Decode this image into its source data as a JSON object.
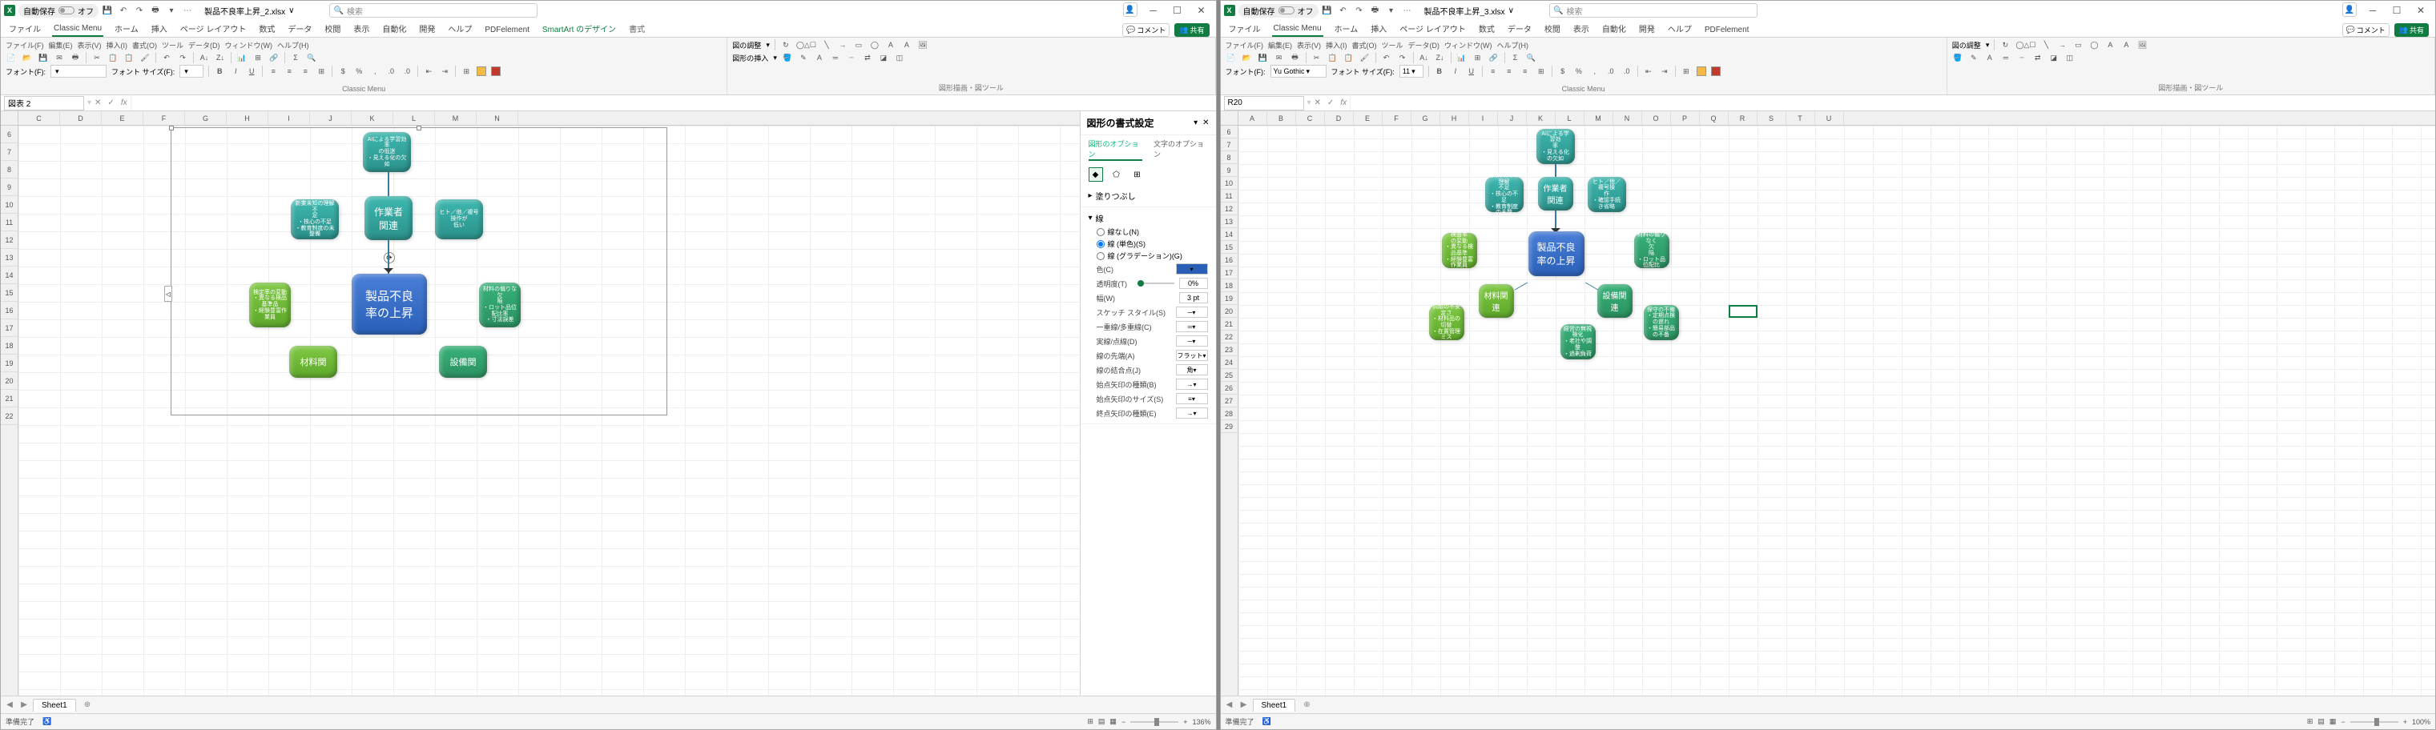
{
  "left": {
    "autosave_label": "自動保存",
    "autosave_state": "オフ",
    "filename": "製品不良率上昇_2.xlsx",
    "filestate": "∨",
    "search_placeholder": "検索",
    "tabs": [
      "ファイル",
      "Classic Menu",
      "ホーム",
      "挿入",
      "ページ レイアウト",
      "数式",
      "データ",
      "校閲",
      "表示",
      "自動化",
      "開発",
      "ヘルプ",
      "PDFelement",
      "SmartArt のデザイン",
      "書式"
    ],
    "comment_label": "コメント",
    "share_label": "共有",
    "ribbon": {
      "classic_label": "Classic Menu",
      "shape_label": "図形描画・図ツール",
      "menus": [
        "ファイル(F)",
        "編集(E)",
        "表示(V)",
        "挿入(I)",
        "書式(O)",
        "ツール",
        "データ(D)",
        "ウィンドウ(W)",
        "ヘルプ(H)"
      ],
      "font_label": "フォント(F):",
      "font_value": "",
      "size_label": "フォント サイズ(F):",
      "size_value": "",
      "adjust_label": "図の調整",
      "insert_shape_label": "図形の挿入"
    },
    "namebox": "図表 2",
    "fx_label": "fx",
    "cols": [
      "C",
      "D",
      "E",
      "F",
      "G",
      "H",
      "I",
      "J",
      "K",
      "L",
      "M",
      "N"
    ],
    "rows": [
      "6",
      "7",
      "8",
      "9",
      "10",
      "11",
      "12",
      "13",
      "14",
      "15",
      "16",
      "17",
      "18",
      "19",
      "20",
      "21",
      "22"
    ],
    "shapes": {
      "top": {
        "lines": [
          "AIによる学習効率",
          "の低迷",
          "・見える化の欠如"
        ]
      },
      "left_mid": {
        "lines": [
          "新業未知の理解不",
          "足",
          "・核心の不足",
          "・教育制度の未整備"
        ]
      },
      "right_mid": {
        "lines": [
          "ヒト／他／複号操作が",
          "低い"
        ]
      },
      "center_upper": "作業者\n関連",
      "left_green": {
        "lines": [
          "検定率の変動",
          "・異なる検品基準品",
          "・経験豊富作業員"
        ]
      },
      "right_green": {
        "lines": [
          "材料の偏りな欠",
          "陥",
          "・ロット品位配比率",
          "・寸法誤差"
        ]
      },
      "center_main": "製品不良\n率の上昇",
      "bottom_left": "材料関",
      "bottom_right": "設備関"
    },
    "fmt": {
      "title": "図形の書式設定",
      "tab_shape": "図形のオプション",
      "tab_text": "文字のオプション",
      "sec_fill": "塗りつぶし",
      "sec_line": "線",
      "radio_none": "線なし(N)",
      "radio_solid": "線 (単色)(S)",
      "radio_grad": "線 (グラデーション)(G)",
      "color_label": "色(C)",
      "trans_label": "透明度(T)",
      "trans_value": "0%",
      "width_label": "幅(W)",
      "width_value": "3 pt",
      "sketch_label": "スケッチ スタイル(S)",
      "compound_label": "一重線/多重線(C)",
      "dash_label": "実線/点線(D)",
      "cap_label": "線の先端(A)",
      "cap_value": "フラット",
      "join_label": "線の結合点(J)",
      "join_value": "角",
      "begin_arrow_type": "始点矢印の種類(B)",
      "begin_arrow_size": "始点矢印のサイズ(S)",
      "end_arrow_type": "終点矢印の種類(E)"
    },
    "sheet": "Sheet1",
    "status": "準備完了",
    "zoom": "136%"
  },
  "right": {
    "autosave_label": "自動保存",
    "autosave_state": "オフ",
    "filename": "製品不良率上昇_3.xlsx",
    "filestate": "∨",
    "search_placeholder": "検索",
    "tabs": [
      "ファイル",
      "Classic Menu",
      "ホーム",
      "挿入",
      "ページ レイアウト",
      "数式",
      "データ",
      "校閲",
      "表示",
      "自動化",
      "開発",
      "ヘルプ",
      "PDFelement"
    ],
    "comment_label": "コメント",
    "share_label": "共有",
    "ribbon": {
      "classic_label": "Classic Menu",
      "shape_label": "図形描画・図ツール",
      "menus": [
        "ファイル(F)",
        "編集(E)",
        "表示(V)",
        "挿入(I)",
        "書式(O)",
        "ツール",
        "データ(D)",
        "ウィンドウ(W)",
        "ヘルプ(H)"
      ],
      "font_label": "フォント(F):",
      "font_value": "Yu Gothic",
      "size_label": "フォント サイズ(F):",
      "size_value": "11",
      "adjust_label": "図の調整"
    },
    "namebox": "R20",
    "fx_label": "fx",
    "cols": [
      "A",
      "B",
      "C",
      "D",
      "E",
      "F",
      "G",
      "H",
      "I",
      "J",
      "K",
      "L",
      "M",
      "N",
      "O",
      "P",
      "Q",
      "R",
      "S",
      "T",
      "U"
    ],
    "rows": [
      "6",
      "7",
      "8",
      "9",
      "10",
      "11",
      "12",
      "13",
      "14",
      "15",
      "16",
      "17",
      "18",
      "19",
      "20",
      "21",
      "22",
      "23",
      "24",
      "25",
      "26",
      "27",
      "28",
      "29"
    ],
    "shapes": {
      "top1": {
        "lines": [
          "AIによる学習効",
          "率",
          "・見える化の欠如"
        ]
      },
      "mid_l": {
        "lines": [
          "新業未知の理解",
          "不足",
          "・核心の不足",
          "・教育制度の未整"
        ]
      },
      "mid_r": {
        "lines": [
          "ヒト／他／複号操",
          "作",
          "・確認手続き省略"
        ]
      },
      "worker": "作業者\n関連",
      "main": "製品不良\n率の上昇",
      "g_tl": {
        "lines": [
          "検査率",
          "の変動",
          "・異なる検品基準",
          "・経験豊富作業員"
        ]
      },
      "g_tr": {
        "lines": [
          "材料の偏りなく",
          "欠",
          "陥",
          "・ロット品位配比"
        ]
      },
      "mat": "材料関\n連",
      "equip": "設備関\n連",
      "g_bl": {
        "lines": [
          "供給の不安定さ",
          "・材料品の切替",
          "・在置管理ミス"
        ]
      },
      "g_br": {
        "lines": [
          "経営の無視検化",
          "・老社や調整",
          "・過剰負荷"
        ]
      },
      "g_br2": {
        "lines": [
          "保守の不備",
          "・定期点検の遅れ",
          "・簡易部品の不备"
        ]
      }
    },
    "sheet": "Sheet1",
    "status": "準備完了",
    "zoom": "100%"
  }
}
